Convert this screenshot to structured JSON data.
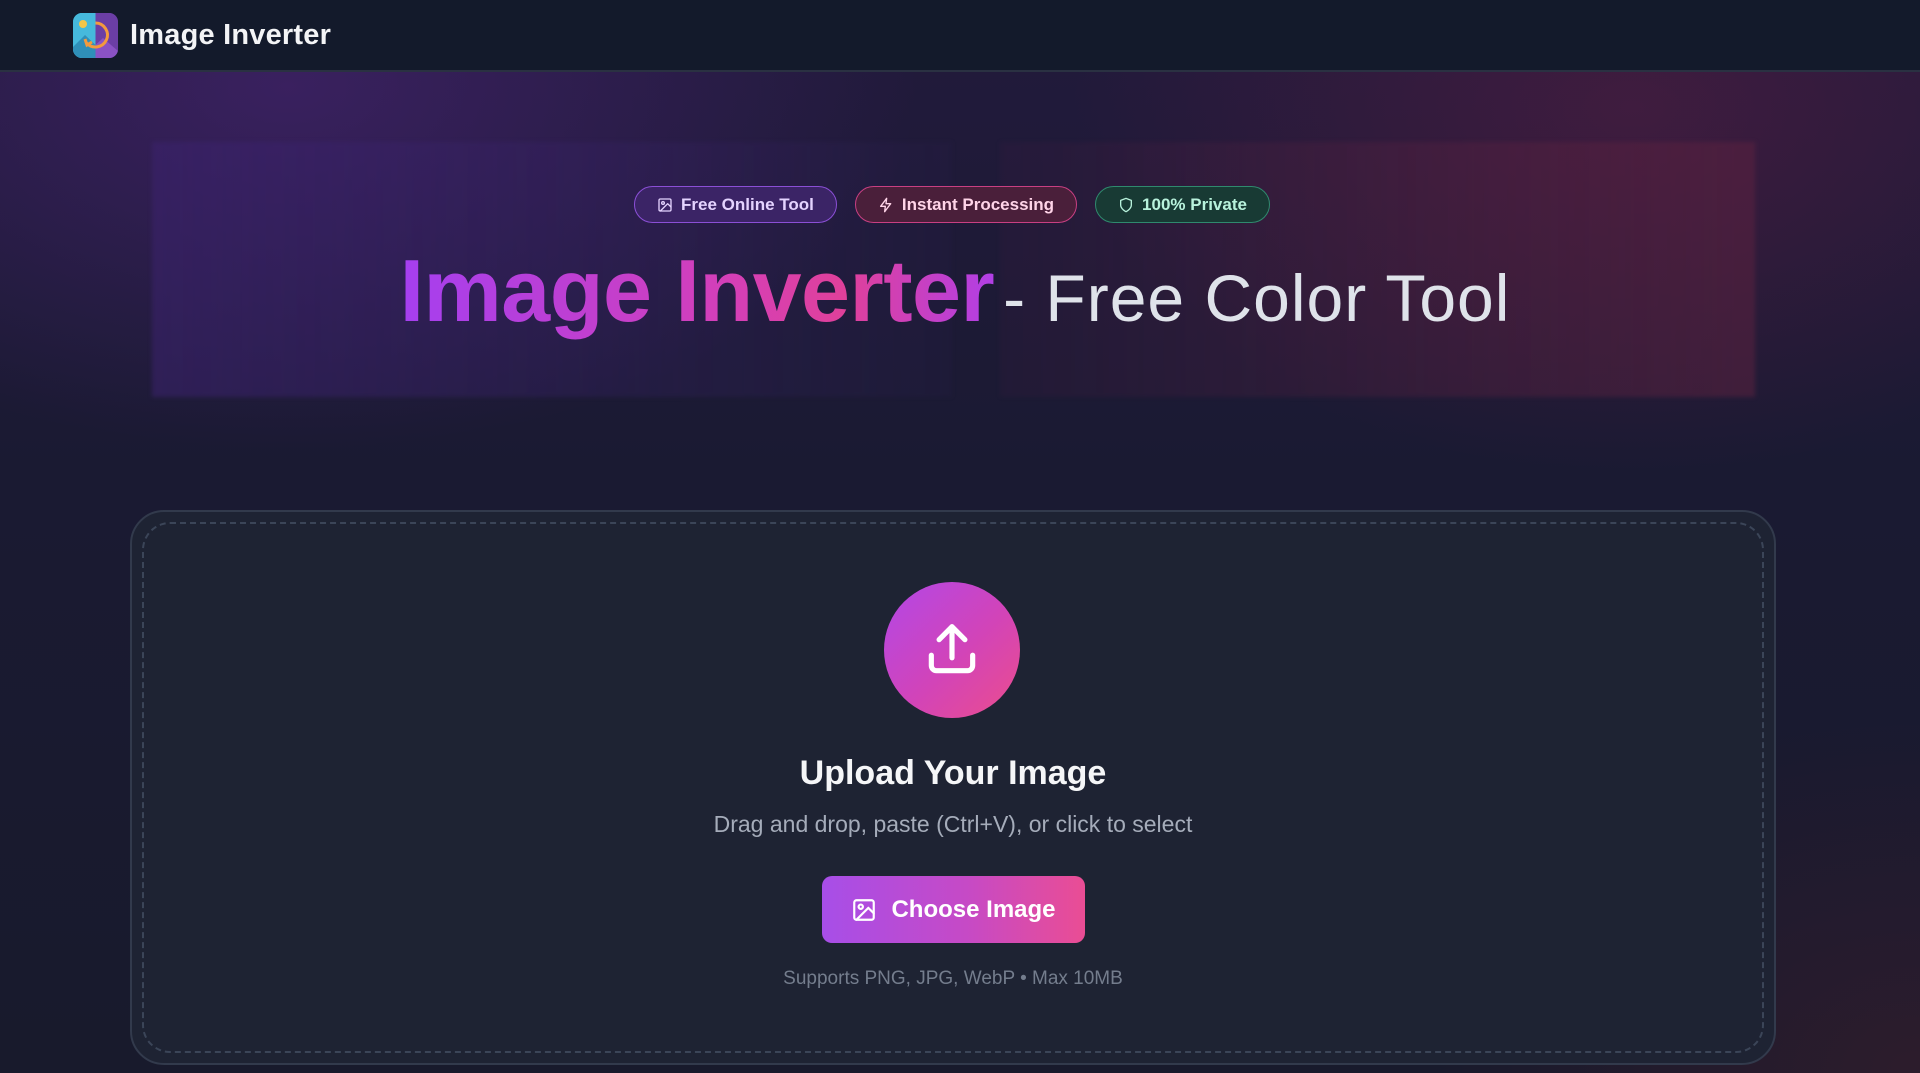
{
  "header": {
    "app_name": "Image Inverter",
    "logo_icon": "image-inverter-logo-icon"
  },
  "badges": [
    {
      "label": "Free Online Tool",
      "icon": "image-icon",
      "color": "#8b4fd6"
    },
    {
      "label": "Instant Processing",
      "icon": "lightning-icon",
      "color": "#c93f82"
    },
    {
      "label": "100% Private",
      "icon": "shield-icon",
      "color": "#2f8a6e"
    }
  ],
  "hero": {
    "title_main": "Image Inverter",
    "title_rest": "- Free Color Tool"
  },
  "upload": {
    "icon": "upload-icon",
    "title": "Upload Your Image",
    "subtitle": "Drag and drop, paste (Ctrl+V), or click to select",
    "button_label": "Choose Image",
    "button_icon": "image-icon",
    "support_text": "Supports PNG, JPG, WebP • Max 10MB"
  },
  "colors": {
    "accent_purple": "#a74ee8",
    "accent_pink": "#ea4d94",
    "background": "#171a2c",
    "card": "#1e2333"
  }
}
